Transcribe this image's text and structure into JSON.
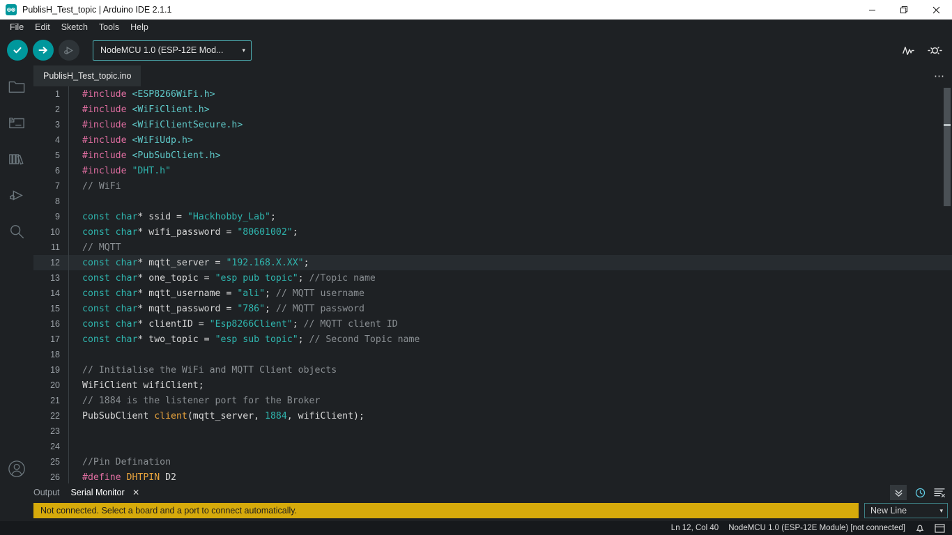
{
  "window": {
    "title": "PublisH_Test_topic | Arduino IDE 2.1.1",
    "app_icon": "arduino-infinity-icon",
    "minimize_label": "—",
    "maximize_label": "❐",
    "close_label": "✕"
  },
  "menubar": {
    "items": [
      {
        "label": "File"
      },
      {
        "label": "Edit"
      },
      {
        "label": "Sketch"
      },
      {
        "label": "Tools"
      },
      {
        "label": "Help"
      }
    ]
  },
  "toolbar": {
    "verify_label": "✓",
    "upload_label": "→",
    "debug_label": "▶",
    "board_selector": {
      "value": "NodeMCU 1.0 (ESP-12E Mod...",
      "caret": "▾"
    },
    "serial_plotter_icon": "serial-plotter-icon",
    "serial_monitor_icon": "serial-monitor-icon"
  },
  "activitybar": {
    "items": [
      {
        "name": "sketchbook",
        "icon": "folder-icon"
      },
      {
        "name": "boards-manager",
        "icon": "board-icon"
      },
      {
        "name": "library-manager",
        "icon": "books-icon"
      },
      {
        "name": "debug",
        "icon": "debug-icon"
      },
      {
        "name": "search",
        "icon": "search-icon"
      }
    ],
    "account_icon": "account-icon"
  },
  "tabbar": {
    "tabs": [
      {
        "label": "PublisH_Test_topic.ino",
        "active": true
      }
    ],
    "more_label": "⋯"
  },
  "editor": {
    "lines": [
      {
        "n": 1,
        "active": false,
        "tokens": [
          {
            "c": "t-pre",
            "t": "#include"
          },
          {
            "c": "t-plain",
            "t": " "
          },
          {
            "c": "t-inc",
            "t": "<ESP8266WiFi.h>"
          }
        ]
      },
      {
        "n": 2,
        "active": false,
        "tokens": [
          {
            "c": "t-pre",
            "t": "#include"
          },
          {
            "c": "t-plain",
            "t": " "
          },
          {
            "c": "t-inc",
            "t": "<WiFiClient.h>"
          }
        ]
      },
      {
        "n": 3,
        "active": false,
        "tokens": [
          {
            "c": "t-pre",
            "t": "#include"
          },
          {
            "c": "t-plain",
            "t": " "
          },
          {
            "c": "t-inc",
            "t": "<WiFiClientSecure.h>"
          }
        ]
      },
      {
        "n": 4,
        "active": false,
        "tokens": [
          {
            "c": "t-pre",
            "t": "#include"
          },
          {
            "c": "t-plain",
            "t": " "
          },
          {
            "c": "t-inc",
            "t": "<WiFiUdp.h>"
          }
        ]
      },
      {
        "n": 5,
        "active": false,
        "tokens": [
          {
            "c": "t-pre",
            "t": "#include"
          },
          {
            "c": "t-plain",
            "t": " "
          },
          {
            "c": "t-inc",
            "t": "<PubSubClient.h>"
          }
        ]
      },
      {
        "n": 6,
        "active": false,
        "tokens": [
          {
            "c": "t-pre",
            "t": "#include"
          },
          {
            "c": "t-plain",
            "t": " "
          },
          {
            "c": "t-str",
            "t": "\"DHT.h\""
          }
        ]
      },
      {
        "n": 7,
        "active": false,
        "tokens": [
          {
            "c": "t-cmt",
            "t": "// WiFi"
          }
        ]
      },
      {
        "n": 8,
        "active": false,
        "tokens": []
      },
      {
        "n": 9,
        "active": false,
        "tokens": [
          {
            "c": "t-kw",
            "t": "const char"
          },
          {
            "c": "t-plain",
            "t": "* ssid = "
          },
          {
            "c": "t-str",
            "t": "\"Hackhobby_Lab\""
          },
          {
            "c": "t-plain",
            "t": ";"
          }
        ]
      },
      {
        "n": 10,
        "active": false,
        "tokens": [
          {
            "c": "t-kw",
            "t": "const char"
          },
          {
            "c": "t-plain",
            "t": "* wifi_password = "
          },
          {
            "c": "t-str",
            "t": "\"80601002\""
          },
          {
            "c": "t-plain",
            "t": ";"
          }
        ]
      },
      {
        "n": 11,
        "active": false,
        "tokens": [
          {
            "c": "t-cmt",
            "t": "// MQTT"
          }
        ]
      },
      {
        "n": 12,
        "active": true,
        "tokens": [
          {
            "c": "t-kw",
            "t": "const char"
          },
          {
            "c": "t-plain",
            "t": "* mqtt_server = "
          },
          {
            "c": "t-str",
            "t": "\"192.168.X.XX\""
          },
          {
            "c": "t-plain",
            "t": ";"
          }
        ]
      },
      {
        "n": 13,
        "active": false,
        "tokens": [
          {
            "c": "t-kw",
            "t": "const char"
          },
          {
            "c": "t-plain",
            "t": "* one_topic = "
          },
          {
            "c": "t-str",
            "t": "\"esp pub topic\""
          },
          {
            "c": "t-plain",
            "t": "; "
          },
          {
            "c": "t-cmt",
            "t": "//Topic name"
          }
        ]
      },
      {
        "n": 14,
        "active": false,
        "tokens": [
          {
            "c": "t-kw",
            "t": "const char"
          },
          {
            "c": "t-plain",
            "t": "* mqtt_username = "
          },
          {
            "c": "t-str",
            "t": "\"ali\""
          },
          {
            "c": "t-plain",
            "t": "; "
          },
          {
            "c": "t-cmt",
            "t": "// MQTT username"
          }
        ]
      },
      {
        "n": 15,
        "active": false,
        "tokens": [
          {
            "c": "t-kw",
            "t": "const char"
          },
          {
            "c": "t-plain",
            "t": "* mqtt_password = "
          },
          {
            "c": "t-str",
            "t": "\"786\""
          },
          {
            "c": "t-plain",
            "t": "; "
          },
          {
            "c": "t-cmt",
            "t": "// MQTT password"
          }
        ]
      },
      {
        "n": 16,
        "active": false,
        "tokens": [
          {
            "c": "t-kw",
            "t": "const char"
          },
          {
            "c": "t-plain",
            "t": "* clientID = "
          },
          {
            "c": "t-str",
            "t": "\"Esp8266Client\""
          },
          {
            "c": "t-plain",
            "t": "; "
          },
          {
            "c": "t-cmt",
            "t": "// MQTT client ID"
          }
        ]
      },
      {
        "n": 17,
        "active": false,
        "tokens": [
          {
            "c": "t-kw",
            "t": "const char"
          },
          {
            "c": "t-plain",
            "t": "* two_topic = "
          },
          {
            "c": "t-str",
            "t": "\"esp sub topic\""
          },
          {
            "c": "t-plain",
            "t": "; "
          },
          {
            "c": "t-cmt",
            "t": "// Second Topic name"
          }
        ]
      },
      {
        "n": 18,
        "active": false,
        "tokens": []
      },
      {
        "n": 19,
        "active": false,
        "tokens": [
          {
            "c": "t-cmt",
            "t": "// Initialise the WiFi and MQTT Client objects"
          }
        ]
      },
      {
        "n": 20,
        "active": false,
        "tokens": [
          {
            "c": "t-plain",
            "t": "WiFiClient wifiClient;"
          }
        ]
      },
      {
        "n": 21,
        "active": false,
        "tokens": [
          {
            "c": "t-cmt",
            "t": "// 1884 is the listener port for the Broker"
          }
        ]
      },
      {
        "n": 22,
        "active": false,
        "tokens": [
          {
            "c": "t-plain",
            "t": "PubSubClient "
          },
          {
            "c": "t-fn",
            "t": "client"
          },
          {
            "c": "t-plain",
            "t": "(mqtt_server, "
          },
          {
            "c": "t-num",
            "t": "1884"
          },
          {
            "c": "t-plain",
            "t": ", wifiClient);"
          }
        ]
      },
      {
        "n": 23,
        "active": false,
        "tokens": []
      },
      {
        "n": 24,
        "active": false,
        "tokens": []
      },
      {
        "n": 25,
        "active": false,
        "tokens": [
          {
            "c": "t-cmt",
            "t": "//Pin Defination"
          }
        ]
      },
      {
        "n": 26,
        "active": false,
        "tokens": [
          {
            "c": "t-pre",
            "t": "#define"
          },
          {
            "c": "t-plain",
            "t": " "
          },
          {
            "c": "t-fn",
            "t": "DHTPIN"
          },
          {
            "c": "t-plain",
            "t": " D2"
          }
        ]
      }
    ]
  },
  "panel": {
    "tabs": [
      {
        "label": "Output",
        "active": false
      },
      {
        "label": "Serial Monitor",
        "active": true,
        "close": "✕"
      }
    ],
    "notice": "Not connected. Select a board and a port to connect automatically.",
    "newline_select": {
      "value": "New Line",
      "caret": "▾"
    },
    "actions": {
      "collapse_icon": "chevron-double-down-icon",
      "timestamp_icon": "clock-icon",
      "clear_icon": "clear-output-icon"
    }
  },
  "statusbar": {
    "cursor_position": "Ln 12, Col 40",
    "board_status": "NodeMCU 1.0 (ESP-12E Module) [not connected]",
    "notification_icon": "bell-icon",
    "layout_icon": "panel-layout-icon"
  },
  "colors": {
    "accent": "#00979c",
    "warning": "#d6aa0b",
    "editor_bg": "#1e2124",
    "active_line": "#272c30"
  }
}
